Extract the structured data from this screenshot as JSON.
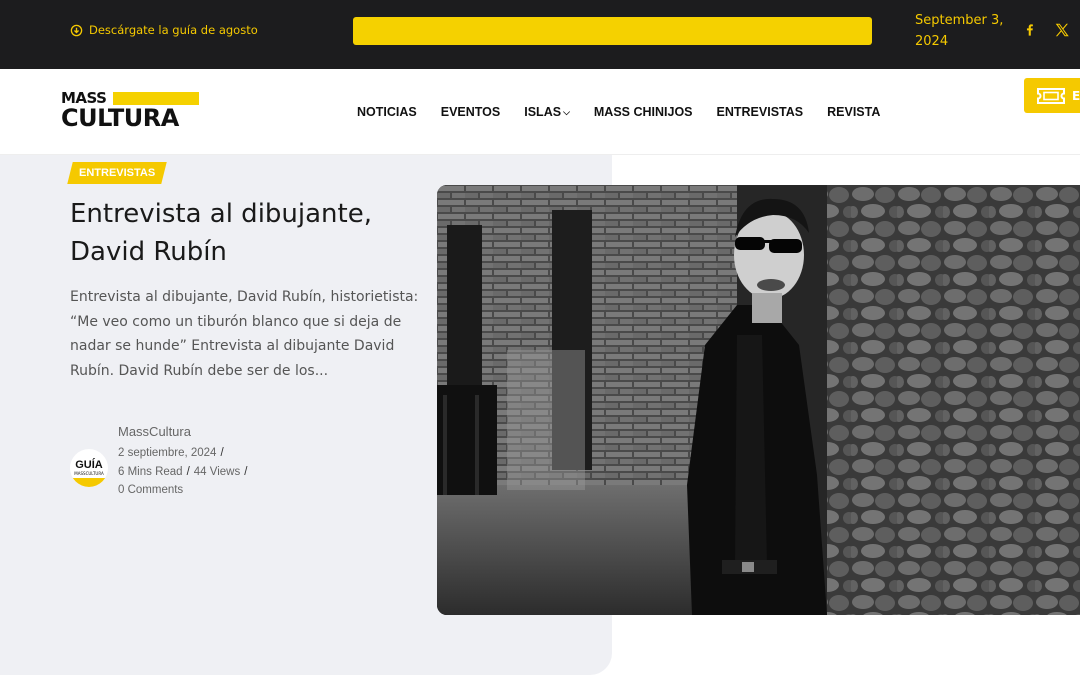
{
  "topbar": {
    "download_label": "Descárgate la guía de agosto",
    "date_line1": "September 3,",
    "date_line2": "2024",
    "icons": [
      "facebook-icon",
      "x-icon"
    ]
  },
  "header": {
    "logo_top": "MASS",
    "logo_bottom": "CULTURA",
    "nav": [
      {
        "label": "NOTICIAS"
      },
      {
        "label": "EVENTOS"
      },
      {
        "label": "ISLAS"
      },
      {
        "label": "MASS CHINIJOS"
      },
      {
        "label": "ENTREVISTAS"
      },
      {
        "label": "REVISTA"
      }
    ],
    "ticket_label": "E"
  },
  "article": {
    "category": "ENTREVISTAS",
    "title": "Entrevista al dibujante, David Rubín",
    "excerpt": "Entrevista al dibujante, David Rubín, historietista:  “Me veo como un tiburón blanco que si deja de nadar se hunde” Entrevista al dibujante David Rubín. David Rubín debe ser de los...",
    "avatar_text": "GUÍA",
    "avatar_sub": "MASSCULTURA",
    "author": "MassCultura",
    "date": "2 septiembre, 2024",
    "read_time": "6 Mins Read",
    "views": "44 Views",
    "comments": "0 Comments"
  },
  "colors": {
    "accent": "#f5c900",
    "topbar_bg": "#1c1c1e",
    "card_bg": "#eff0f4"
  }
}
